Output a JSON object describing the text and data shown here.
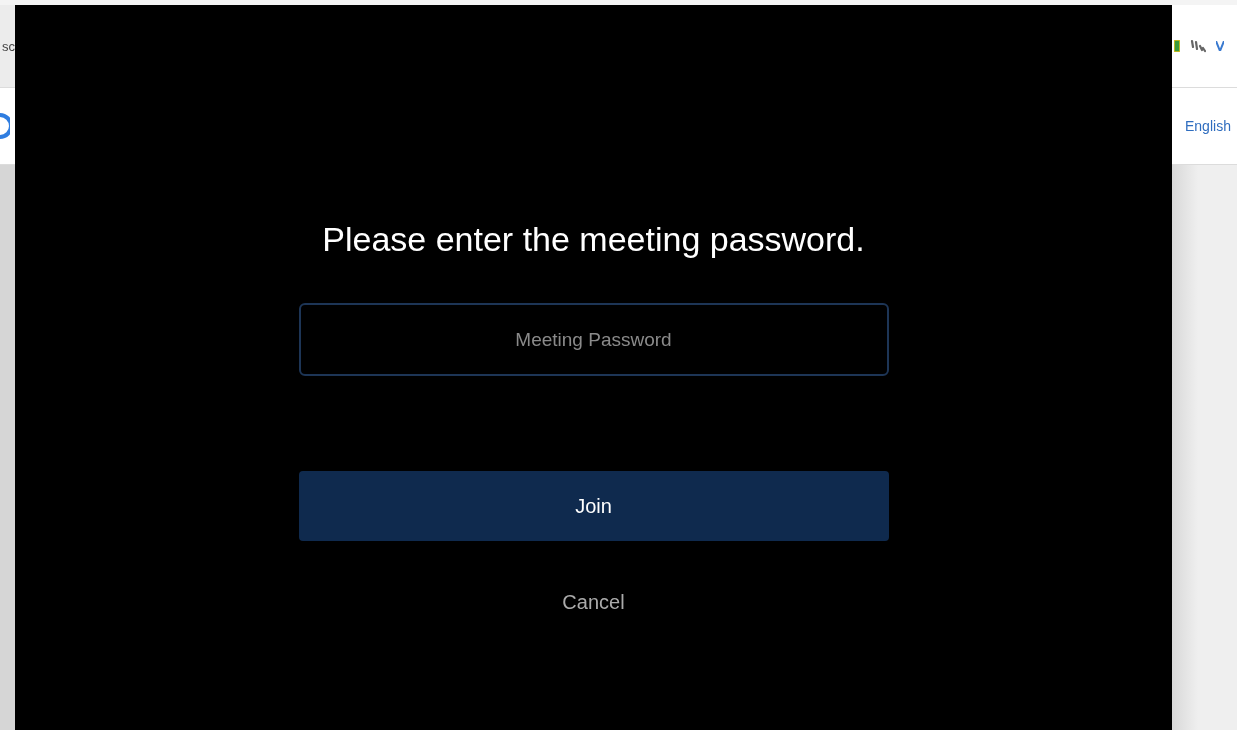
{
  "background_page": {
    "header_text": "sc",
    "language_link": "English"
  },
  "dialog": {
    "title": "Please enter the meeting password.",
    "password_field": {
      "placeholder": "Meeting Password"
    },
    "join_button": "Join",
    "cancel_button": "Cancel"
  }
}
